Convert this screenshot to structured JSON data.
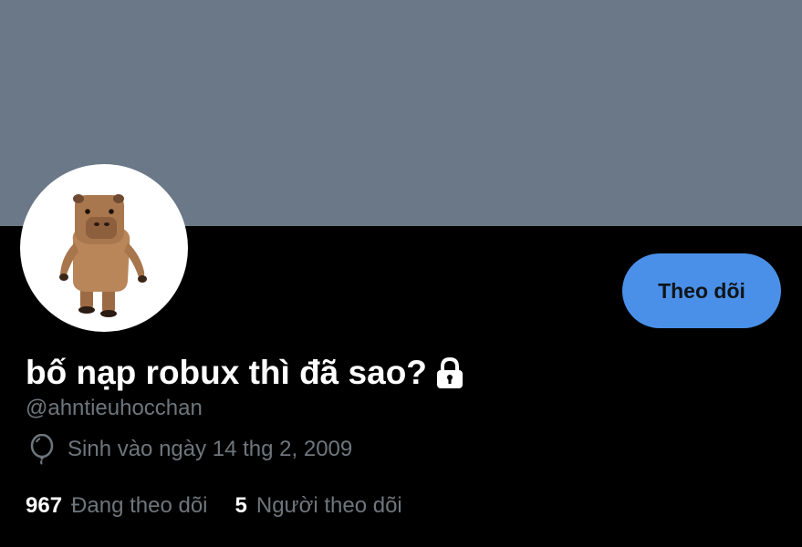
{
  "profile": {
    "display_name": "bố nạp robux thì đã sao?",
    "handle": "@ahntieuhocchan",
    "birth_date": "Sinh vào ngày 14 thg 2, 2009",
    "protected": true
  },
  "actions": {
    "follow_label": "Theo dõi"
  },
  "stats": {
    "following_count": "967",
    "following_label": "Đang theo dõi",
    "followers_count": "5",
    "followers_label": "Người theo dõi"
  },
  "icons": {
    "lock": "lock-icon",
    "birthday": "balloon-icon"
  },
  "colors": {
    "banner": "#6a7887",
    "background": "#000000",
    "follow_button": "#4a90e8",
    "secondary_text": "#6e767d"
  }
}
